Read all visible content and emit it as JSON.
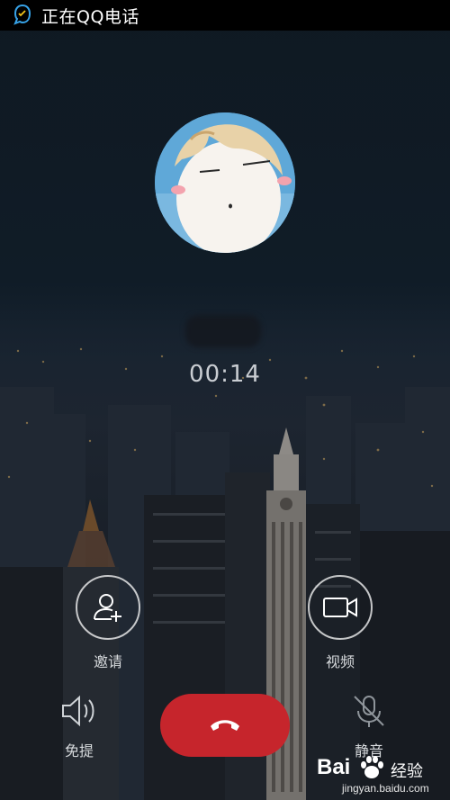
{
  "status_bar": {
    "title": "正在QQ电话",
    "icon": "qq-call-icon"
  },
  "call": {
    "contact_avatar": "cartoon-avatar",
    "duration": "00:14"
  },
  "actions": {
    "invite_label": "邀请",
    "video_label": "视频",
    "speaker_label": "免提",
    "mute_label": "静音",
    "end_call": "end-call-icon"
  },
  "watermark": {
    "logo": "Bai",
    "brand": "经验",
    "url": "jingyan.baidu.com"
  },
  "colors": {
    "end_call": "#c6252c",
    "background": "#0f1821"
  }
}
